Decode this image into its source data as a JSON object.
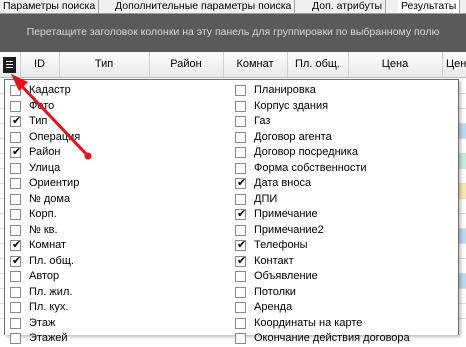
{
  "tabs": [
    {
      "label": "Параметры поиска"
    },
    {
      "label": "Дополнительные параметры поиска"
    },
    {
      "label": "Доп. атрибуты"
    },
    {
      "label": "Результаты"
    }
  ],
  "group_panel": {
    "hint": "Перетащите заголовок колонки на эту панель для группировки по выбранному полю"
  },
  "columns": [
    {
      "label": "ID"
    },
    {
      "label": "Тип"
    },
    {
      "label": "Район"
    },
    {
      "label": "Комнат"
    },
    {
      "label": "Пл. общ."
    },
    {
      "label": "Цена"
    },
    {
      "label": "Цен"
    }
  ],
  "column_chooser": {
    "left": [
      {
        "label": "Кадастр",
        "checked": false
      },
      {
        "label": "Фото",
        "checked": false
      },
      {
        "label": "Тип",
        "checked": true
      },
      {
        "label": "Операция",
        "checked": false
      },
      {
        "label": "Район",
        "checked": true
      },
      {
        "label": "Улица",
        "checked": false
      },
      {
        "label": "Ориентир",
        "checked": false
      },
      {
        "label": "№ дома",
        "checked": false
      },
      {
        "label": "Корп.",
        "checked": false
      },
      {
        "label": "№ кв.",
        "checked": false
      },
      {
        "label": "Комнат",
        "checked": true
      },
      {
        "label": "Пл. общ.",
        "checked": true
      },
      {
        "label": "Автор",
        "checked": false
      },
      {
        "label": "Пл. жил.",
        "checked": false
      },
      {
        "label": "Пл. кух.",
        "checked": false
      },
      {
        "label": "Этаж",
        "checked": false
      },
      {
        "label": "Этажей",
        "checked": false
      }
    ],
    "right": [
      {
        "label": "Планировка",
        "checked": false
      },
      {
        "label": "Корпус здания",
        "checked": false
      },
      {
        "label": "Газ",
        "checked": false
      },
      {
        "label": "Договор агента",
        "checked": false
      },
      {
        "label": "Договор посредника",
        "checked": false
      },
      {
        "label": "Форма собственности",
        "checked": false
      },
      {
        "label": "Дата вноса",
        "checked": true
      },
      {
        "label": "ДПИ",
        "checked": false
      },
      {
        "label": "Примечание",
        "checked": true
      },
      {
        "label": "Примечание2",
        "checked": false
      },
      {
        "label": "Телефоны",
        "checked": true
      },
      {
        "label": "Контакт",
        "checked": true
      },
      {
        "label": "Объявление",
        "checked": false
      },
      {
        "label": "Потолки",
        "checked": false
      },
      {
        "label": "Аренда",
        "checked": false
      },
      {
        "label": "Координаты на карте",
        "checked": false
      },
      {
        "label": "Окончание действия договора",
        "checked": false
      }
    ]
  },
  "colors": {
    "annotation": "#e8101a",
    "group_panel": "#5a5a5a",
    "row_highlights": [
      "#b7dbf0",
      "#bfeedd",
      "#f7e8b0"
    ]
  }
}
